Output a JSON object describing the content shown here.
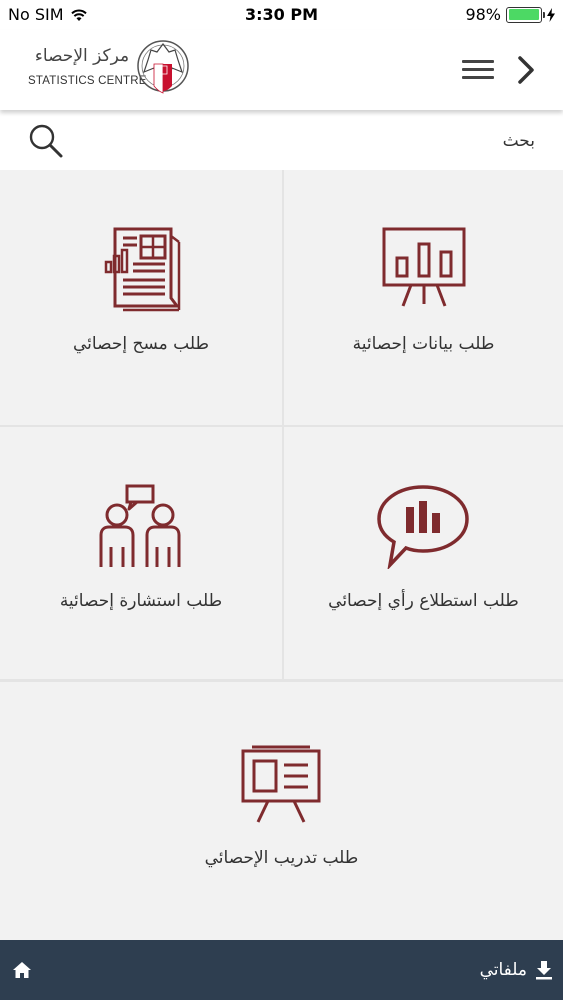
{
  "status_bar": {
    "carrier": "No SIM",
    "time": "3:30 PM",
    "battery_percent": "98%",
    "battery_level": 0.98,
    "battery_color": "#4cd964"
  },
  "header": {
    "logo_arabic": "مركز الإحصاء",
    "logo_english": "STATISTICS CENTRE",
    "menu_icon": "hamburger-icon",
    "back_icon": "chevron-right-icon"
  },
  "search": {
    "placeholder": "بحث",
    "icon": "search-icon"
  },
  "tiles": [
    {
      "label": "طلب بيانات إحصائية",
      "icon": "presentation-bar-chart-icon"
    },
    {
      "label": "طلب مسح إحصائي",
      "icon": "survey-document-icon"
    },
    {
      "label": "طلب استطلاع رأي إحصائي",
      "icon": "speech-bubble-chart-icon"
    },
    {
      "label": "طلب استشارة إحصائية",
      "icon": "consultation-people-icon"
    },
    {
      "label": "طلب تدريب الإحصائي",
      "icon": "training-board-icon"
    }
  ],
  "footer": {
    "files_label": "ملفاتي",
    "files_icon": "download-icon",
    "home_icon": "home-icon"
  },
  "colors": {
    "accent": "#7f2b2e",
    "tile_background": "#f2f2f2",
    "footer_background": "#2e3e50"
  }
}
